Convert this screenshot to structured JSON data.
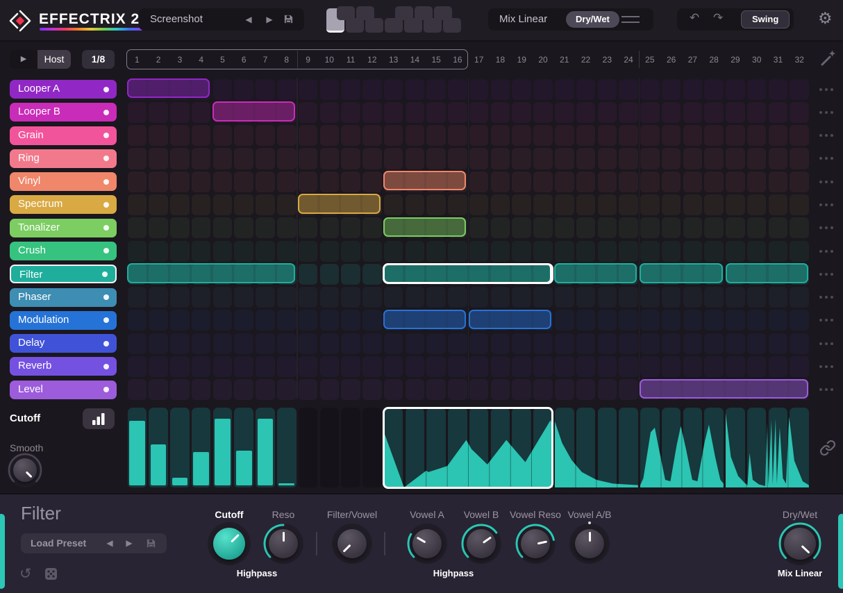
{
  "app": {
    "title": "EFFECTRIX 2"
  },
  "topbar": {
    "preset": {
      "value": "Screenshot"
    },
    "pattern_selector": {
      "key_count": 12,
      "selected_index": 0
    },
    "mix_linear_label": "Mix Linear",
    "drywet_label": "Dry/Wet",
    "swing_label": "Swing"
  },
  "transport": {
    "host_label": "Host",
    "rate_value": "1/8"
  },
  "grid": {
    "steps": 32,
    "loop_steps": 16,
    "step_numbers": [
      1,
      2,
      3,
      4,
      5,
      6,
      7,
      8,
      9,
      10,
      11,
      12,
      13,
      14,
      15,
      16,
      17,
      18,
      19,
      20,
      21,
      22,
      23,
      24,
      25,
      26,
      27,
      28,
      29,
      30,
      31,
      32
    ],
    "section_dividers": [
      8,
      16,
      24
    ]
  },
  "tracks": [
    {
      "name": "Looper A",
      "color": "#9128c6",
      "blocks": [
        {
          "start": 1,
          "len": 4
        }
      ]
    },
    {
      "name": "Looper B",
      "color": "#c92cb8",
      "blocks": [
        {
          "start": 5,
          "len": 4
        }
      ]
    },
    {
      "name": "Grain",
      "color": "#f2549b",
      "blocks": []
    },
    {
      "name": "Ring",
      "color": "#f2798c",
      "blocks": []
    },
    {
      "name": "Vinyl",
      "color": "#f0876a",
      "blocks": [
        {
          "start": 13,
          "len": 4
        }
      ]
    },
    {
      "name": "Spectrum",
      "color": "#d9a944",
      "blocks": [
        {
          "start": 9,
          "len": 4
        }
      ]
    },
    {
      "name": "Tonalizer",
      "color": "#7ccd62",
      "blocks": [
        {
          "start": 13,
          "len": 4
        }
      ]
    },
    {
      "name": "Crush",
      "color": "#36c37f",
      "blocks": []
    },
    {
      "name": "Filter",
      "color": "#1fae9c",
      "selected": true,
      "blocks": [
        {
          "start": 1,
          "len": 8
        },
        {
          "start": 13,
          "len": 8,
          "selected": true
        },
        {
          "start": 21,
          "len": 4
        },
        {
          "start": 25,
          "len": 4
        },
        {
          "start": 29,
          "len": 4
        }
      ]
    },
    {
      "name": "Phaser",
      "color": "#3e8db2",
      "blocks": []
    },
    {
      "name": "Modulation",
      "color": "#2673d8",
      "blocks": [
        {
          "start": 13,
          "len": 4
        },
        {
          "start": 17,
          "len": 4
        }
      ]
    },
    {
      "name": "Delay",
      "color": "#4053d8",
      "blocks": []
    },
    {
      "name": "Reverb",
      "color": "#7551e2",
      "blocks": []
    },
    {
      "name": "Level",
      "color": "#9c5cdb",
      "blocks": [
        {
          "start": 25,
          "len": 8
        }
      ]
    }
  ],
  "automation": {
    "param_label": "Cutoff",
    "smooth_label": "Smooth",
    "fill_color": "#2cc4b2",
    "segments": [
      {
        "type": "bars",
        "start": 1,
        "len": 8,
        "values": [
          0.87,
          0.55,
          0.1,
          0.45,
          0.9,
          0.47,
          0.9,
          0.03
        ]
      },
      {
        "type": "poly",
        "start": 13,
        "len": 8,
        "selected": true,
        "points": [
          [
            0,
            0.72
          ],
          [
            0.95,
            0.0
          ],
          [
            2.0,
            0.22
          ],
          [
            2.1,
            0.2
          ],
          [
            3.0,
            0.28
          ],
          [
            3.9,
            0.62
          ],
          [
            4.15,
            0.5
          ],
          [
            4.9,
            0.3
          ],
          [
            5.8,
            0.62
          ],
          [
            6.7,
            0.33
          ],
          [
            7.9,
            0.88
          ],
          [
            8,
            0.78
          ]
        ]
      },
      {
        "type": "poly",
        "start": 21,
        "len": 4,
        "points": [
          [
            0,
            0.86
          ],
          [
            0.35,
            0.58
          ],
          [
            0.8,
            0.36
          ],
          [
            1.3,
            0.2
          ],
          [
            2.0,
            0.1
          ],
          [
            2.8,
            0.05
          ],
          [
            4,
            0.03
          ]
        ]
      },
      {
        "type": "poly",
        "start": 25,
        "len": 4,
        "points": [
          [
            0,
            0.03
          ],
          [
            0.15,
            0.12
          ],
          [
            0.5,
            0.72
          ],
          [
            0.7,
            0.78
          ],
          [
            0.9,
            0.5
          ],
          [
            1.2,
            0.1
          ],
          [
            1.45,
            0.08
          ],
          [
            1.75,
            0.55
          ],
          [
            1.95,
            0.8
          ],
          [
            2.2,
            0.5
          ],
          [
            2.5,
            0.1
          ],
          [
            2.75,
            0.08
          ],
          [
            3.1,
            0.6
          ],
          [
            3.3,
            0.82
          ],
          [
            3.6,
            0.4
          ],
          [
            3.85,
            0.1
          ],
          [
            4,
            0.05
          ]
        ]
      },
      {
        "type": "poly",
        "start": 29,
        "len": 4,
        "points": [
          [
            0,
            0.97
          ],
          [
            0.25,
            0.4
          ],
          [
            0.6,
            0.15
          ],
          [
            0.95,
            0.05
          ],
          [
            1.05,
            0.03
          ],
          [
            1.15,
            0.45
          ],
          [
            1.3,
            0.1
          ],
          [
            1.6,
            0.04
          ],
          [
            1.9,
            0.02
          ],
          [
            2.0,
            0.85
          ],
          [
            2.06,
            0.03
          ],
          [
            2.2,
            0.88
          ],
          [
            2.26,
            0.04
          ],
          [
            2.4,
            0.9
          ],
          [
            2.46,
            0.05
          ],
          [
            2.6,
            0.78
          ],
          [
            2.75,
            0.12
          ],
          [
            2.9,
            0.05
          ],
          [
            3.05,
            0.92
          ],
          [
            3.3,
            0.35
          ],
          [
            3.7,
            0.08
          ],
          [
            4,
            0.03
          ]
        ]
      }
    ]
  },
  "editor": {
    "title": "Filter",
    "preset_label": "Load Preset",
    "knobs": [
      {
        "label": "Cutoff",
        "sublabel": "Highpass",
        "pointer_deg": 45,
        "arc_frac": null,
        "teal": true,
        "bold_label": true
      },
      {
        "label": "Reso",
        "pointer_deg": 0,
        "arc_frac": 0.5
      },
      {
        "label": "Filter/Vowel",
        "pointer_deg": -135,
        "arc_frac": 0
      },
      {
        "label": "Vowel A",
        "sublabel": "Highpass",
        "pointer_deg": -60,
        "arc_frac": 0.28
      },
      {
        "label": "Vowel B",
        "pointer_deg": 55,
        "arc_frac": 0.7
      },
      {
        "label": "Vowel Reso",
        "pointer_deg": 78,
        "arc_frac": 0.79
      },
      {
        "label": "Vowel A/B",
        "pointer_deg": 0,
        "arc_frac": 0,
        "dot": true
      },
      {
        "label": "Dry/Wet",
        "sublabel": "Mix Linear",
        "pointer_deg": 133,
        "arc_frac": 1.0,
        "bold_sublabel": true
      }
    ]
  }
}
